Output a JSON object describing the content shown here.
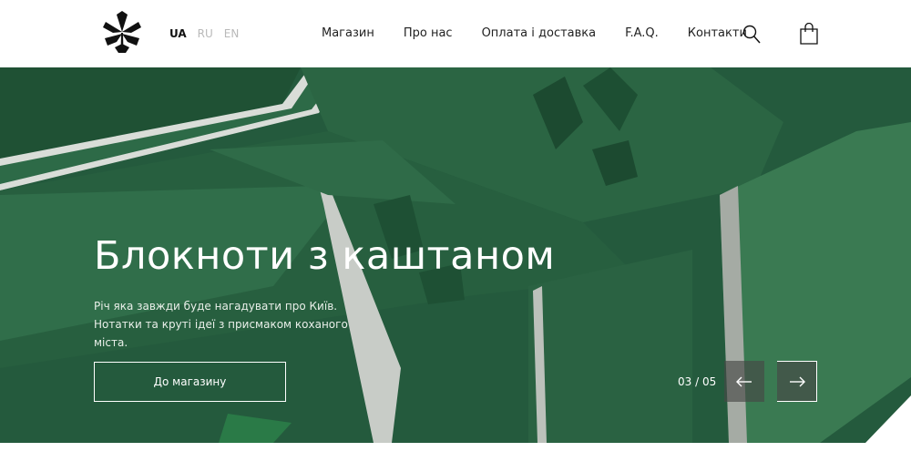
{
  "header": {
    "logo_icon": "chestnut-leaf-icon",
    "languages": [
      {
        "code": "UA",
        "active": true
      },
      {
        "code": "RU",
        "active": false
      },
      {
        "code": "EN",
        "active": false
      }
    ],
    "nav": [
      "Магазин",
      "Про нас",
      "Оплата і доставка",
      "F.A.Q.",
      "Контакти"
    ],
    "search_icon": "search-icon",
    "cart_icon": "shopping-bag-icon"
  },
  "hero": {
    "title": "Блокноти з каштаном",
    "description": "Річ яка завжди буде нагадувати про Київ. Нотатки та круті ідеї з присмаком коханого міста.",
    "cta_label": "До магазину",
    "counter": "03 / 05",
    "prev_icon": "arrow-left-icon",
    "next_icon": "arrow-right-icon"
  },
  "colors": {
    "hero_green": "#245a3d",
    "text_dark": "#111111",
    "inactive_lang": "#b9b9b9"
  }
}
